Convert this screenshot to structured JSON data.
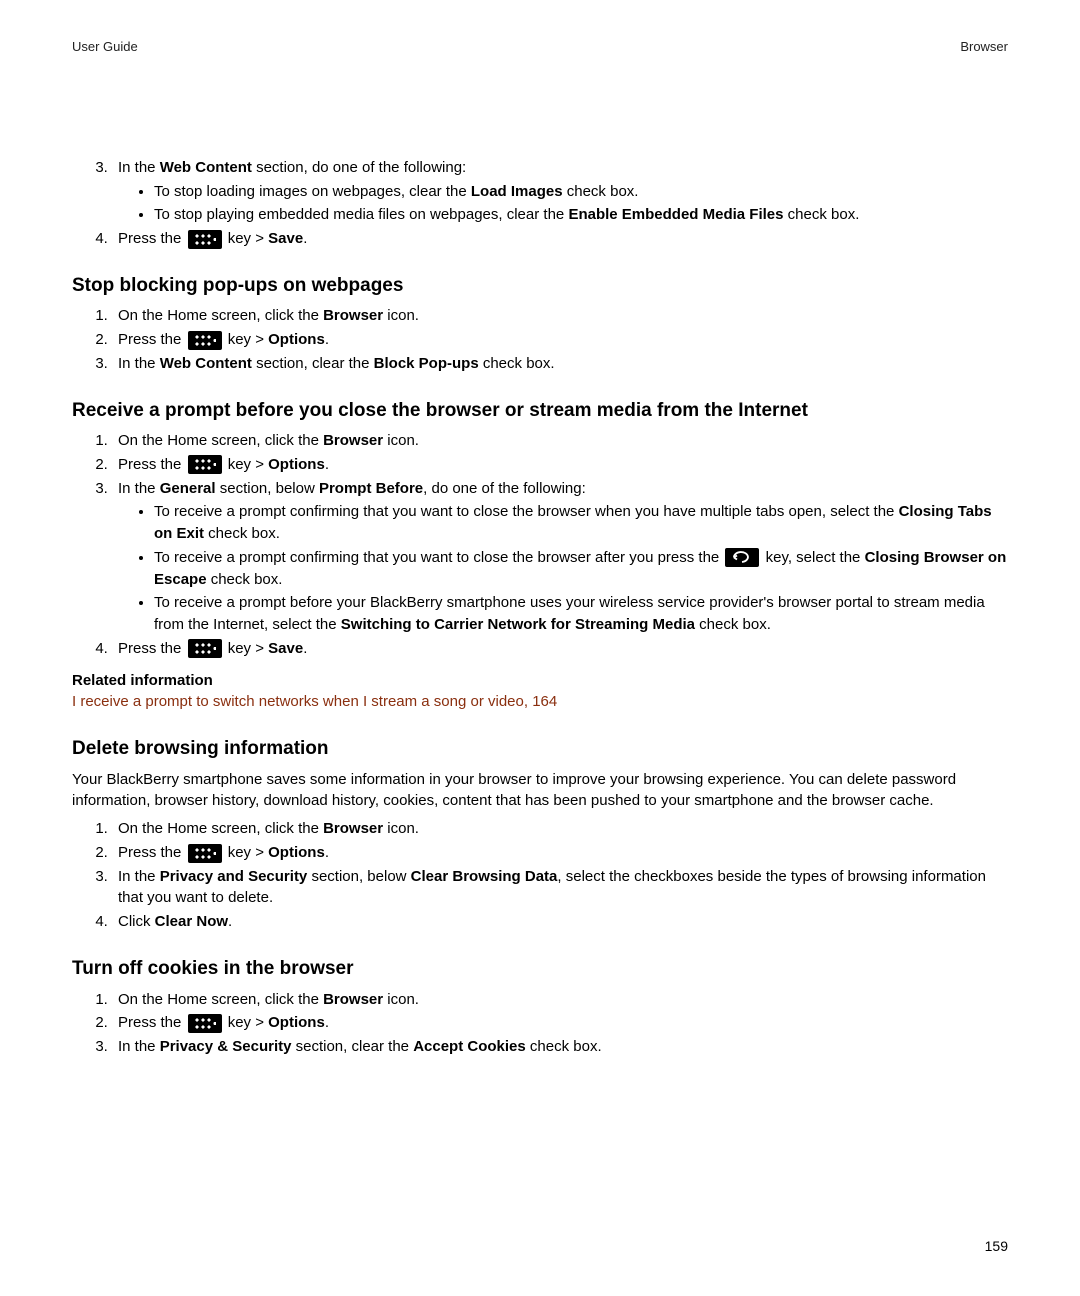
{
  "header": {
    "left": "User Guide",
    "right": "Browser"
  },
  "footer": {
    "page": "159"
  },
  "sec0": {
    "step3_intro_a": "In the ",
    "step3_intro_b": "Web Content",
    "step3_intro_c": " section, do one of the following:",
    "b1_a": "To stop loading images on webpages, clear the ",
    "b1_b": "Load Images",
    "b1_c": " check box.",
    "b2_a": "To stop playing embedded media files on webpages, clear the ",
    "b2_b": "Enable Embedded Media Files",
    "b2_c": " check box.",
    "step4_a": "Press the ",
    "step4_b": " key > ",
    "step4_c": "Save",
    "step4_d": "."
  },
  "sec1": {
    "heading": "Stop blocking pop-ups on webpages",
    "s1_a": "On the Home screen, click the ",
    "s1_b": "Browser",
    "s1_c": " icon.",
    "s2_a": "Press the ",
    "s2_b": " key > ",
    "s2_c": "Options",
    "s2_d": ".",
    "s3_a": "In the ",
    "s3_b": "Web Content",
    "s3_c": " section, clear the ",
    "s3_d": "Block Pop-ups",
    "s3_e": " check box."
  },
  "sec2": {
    "heading": "Receive a prompt before you close the browser or stream media from the Internet",
    "s1_a": "On the Home screen, click the ",
    "s1_b": "Browser",
    "s1_c": " icon.",
    "s2_a": "Press the ",
    "s2_b": " key > ",
    "s2_c": "Options",
    "s2_d": ".",
    "s3_a": "In the ",
    "s3_b": "General",
    "s3_c": " section, below ",
    "s3_d": "Prompt Before",
    "s3_e": ", do one of the following:",
    "b1_a": "To receive a prompt confirming that you want to close the browser when you have multiple tabs open, select the ",
    "b1_b": "Closing Tabs on Exit",
    "b1_c": " check box.",
    "b2_a": "To receive a prompt confirming that you want to close the browser after you press the ",
    "b2_b": " key, select the ",
    "b2_c": "Closing Browser on Escape",
    "b2_d": " check box.",
    "b3_a": "To receive a prompt before your BlackBerry smartphone uses your wireless service provider's browser portal to stream media from the Internet, select the ",
    "b3_b": "Switching to Carrier Network for Streaming Media",
    "b3_c": " check box.",
    "s4_a": "Press the ",
    "s4_b": " key > ",
    "s4_c": "Save",
    "s4_d": ".",
    "rel_head": "Related information",
    "rel_link": "I receive a prompt to switch networks when I stream a song or video, 164"
  },
  "sec3": {
    "heading": "Delete browsing information",
    "para": "Your BlackBerry smartphone saves some information in your browser to improve your browsing experience. You can delete password information, browser history, download history, cookies, content that has been pushed to your smartphone and the browser cache.",
    "s1_a": "On the Home screen, click the ",
    "s1_b": "Browser",
    "s1_c": " icon.",
    "s2_a": "Press the ",
    "s2_b": " key > ",
    "s2_c": "Options",
    "s2_d": ".",
    "s3_a": "In the ",
    "s3_b": "Privacy and Security",
    "s3_c": " section, below ",
    "s3_d": "Clear Browsing Data",
    "s3_e": ", select the checkboxes beside the types of browsing information that you want to delete.",
    "s4_a": "Click ",
    "s4_b": "Clear Now",
    "s4_c": "."
  },
  "sec4": {
    "heading": "Turn off cookies in the browser",
    "s1_a": "On the Home screen, click the ",
    "s1_b": "Browser",
    "s1_c": " icon.",
    "s2_a": "Press the ",
    "s2_b": " key > ",
    "s2_c": "Options",
    "s2_d": ".",
    "s3_a": "In the ",
    "s3_b": "Privacy & Security",
    "s3_c": " section, clear the ",
    "s3_d": "Accept Cookies",
    "s3_e": " check box."
  }
}
